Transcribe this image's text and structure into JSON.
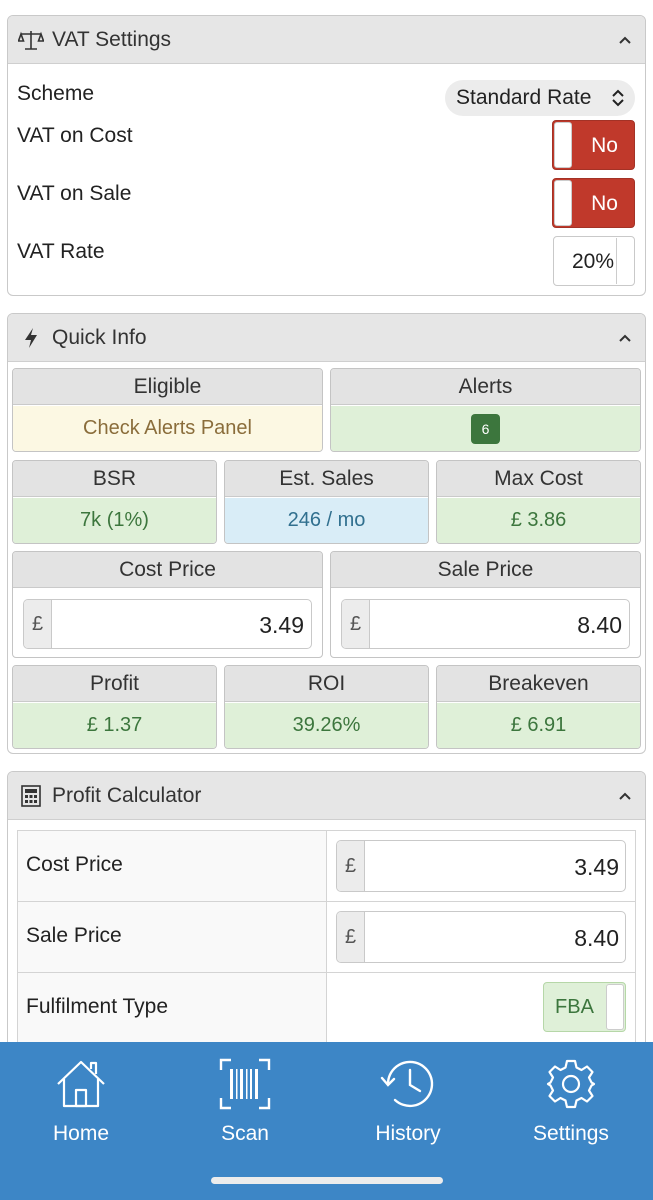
{
  "vat_settings": {
    "title": "VAT Settings",
    "icon": "scales-icon",
    "scheme_label": "Scheme",
    "scheme_value": "Standard Rate",
    "vat_on_cost_label": "VAT on Cost",
    "vat_on_cost_value": "No",
    "vat_on_sale_label": "VAT on Sale",
    "vat_on_sale_value": "No",
    "vat_rate_label": "VAT Rate",
    "vat_rate_value": "20%"
  },
  "quick_info": {
    "title": "Quick Info",
    "icon": "bolt-icon",
    "eligible_label": "Eligible",
    "eligible_value": "Check Alerts Panel",
    "alerts_label": "Alerts",
    "alerts_value": "6",
    "bsr_label": "BSR",
    "bsr_value": "7k (1%)",
    "est_sales_label": "Est. Sales",
    "est_sales_value": "246 / mo",
    "max_cost_label": "Max Cost",
    "max_cost_value": "£ 3.86",
    "cost_price_label": "Cost Price",
    "cost_price_currency": "£",
    "cost_price_value": "3.49",
    "sale_price_label": "Sale Price",
    "sale_price_currency": "£",
    "sale_price_value": "8.40",
    "profit_label": "Profit",
    "profit_value": "£ 1.37",
    "roi_label": "ROI",
    "roi_value": "39.26%",
    "breakeven_label": "Breakeven",
    "breakeven_value": "£ 6.91"
  },
  "profit_calculator": {
    "title": "Profit Calculator",
    "icon": "calculator-icon",
    "rows": [
      {
        "label": "Cost Price",
        "currency": "£",
        "value": "3.49"
      },
      {
        "label": "Sale Price",
        "currency": "£",
        "value": "8.40"
      },
      {
        "label": "Fulfilment Type",
        "value": "FBA"
      }
    ]
  },
  "bottom_nav": {
    "items": [
      {
        "label": "Home",
        "icon": "home-icon"
      },
      {
        "label": "Scan",
        "icon": "barcode-scan-icon"
      },
      {
        "label": "History",
        "icon": "history-icon"
      },
      {
        "label": "Settings",
        "icon": "gear-icon"
      }
    ]
  },
  "colors": {
    "accent_nav": "#3d86c6",
    "toggle_off": "#c0392b",
    "success_bg": "#dff0d8",
    "success_text": "#3c763d",
    "warning_bg": "#fcf8e3",
    "info_bg": "#d9edf7"
  }
}
